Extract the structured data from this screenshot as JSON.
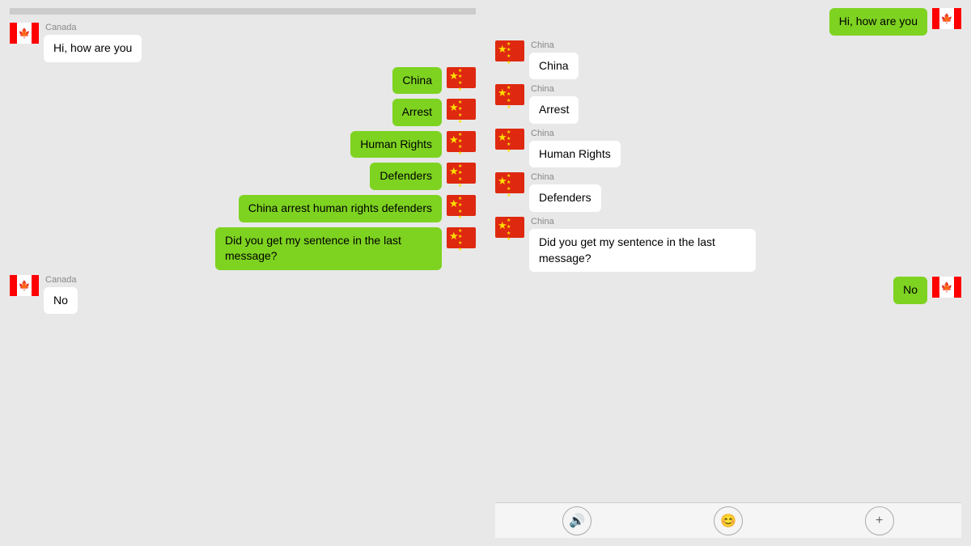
{
  "left_panel": {
    "messages": [
      {
        "id": "left-1",
        "side": "left",
        "flag": "canada",
        "sender": "Canada",
        "text": "Hi, how are you",
        "bubble_color": "white"
      },
      {
        "id": "left-2",
        "side": "right",
        "flag": "china",
        "sender": "",
        "text": "China",
        "bubble_color": "green"
      },
      {
        "id": "left-3",
        "side": "right",
        "flag": "china",
        "sender": "",
        "text": "Arrest",
        "bubble_color": "green"
      },
      {
        "id": "left-4",
        "side": "right",
        "flag": "china",
        "sender": "",
        "text": "Human Rights",
        "bubble_color": "green"
      },
      {
        "id": "left-5",
        "side": "right",
        "flag": "china",
        "sender": "",
        "text": "Defenders",
        "bubble_color": "green"
      },
      {
        "id": "left-6",
        "side": "right",
        "flag": "china",
        "sender": "",
        "text": "China arrest human rights defenders",
        "bubble_color": "green"
      },
      {
        "id": "left-7",
        "side": "right",
        "flag": "china",
        "sender": "",
        "text": "Did you get my sentence in the last message?",
        "bubble_color": "green"
      },
      {
        "id": "left-8",
        "side": "left",
        "flag": "canada",
        "sender": "Canada",
        "text": "No",
        "bubble_color": "white"
      }
    ]
  },
  "right_panel": {
    "messages": [
      {
        "id": "right-1",
        "side": "right",
        "flag": "canada",
        "sender": "",
        "text": "Hi, how are you",
        "bubble_color": "green"
      },
      {
        "id": "right-2",
        "side": "left",
        "flag": "china",
        "sender": "China",
        "text": "China",
        "bubble_color": "white"
      },
      {
        "id": "right-3",
        "side": "left",
        "flag": "china",
        "sender": "China",
        "text": "Arrest",
        "bubble_color": "white"
      },
      {
        "id": "right-4",
        "side": "left",
        "flag": "china",
        "sender": "China",
        "text": "Human Rights",
        "bubble_color": "white"
      },
      {
        "id": "right-5",
        "side": "left",
        "flag": "china",
        "sender": "China",
        "text": "Defenders",
        "bubble_color": "white"
      },
      {
        "id": "right-6",
        "side": "left",
        "flag": "china",
        "sender": "China",
        "text": "Did you get my sentence in the last message?",
        "bubble_color": "white"
      },
      {
        "id": "right-7",
        "side": "right",
        "flag": "canada",
        "sender": "",
        "text": "No",
        "bubble_color": "green"
      }
    ]
  },
  "bottom_icons": [
    "🔊",
    "😊",
    "+"
  ]
}
